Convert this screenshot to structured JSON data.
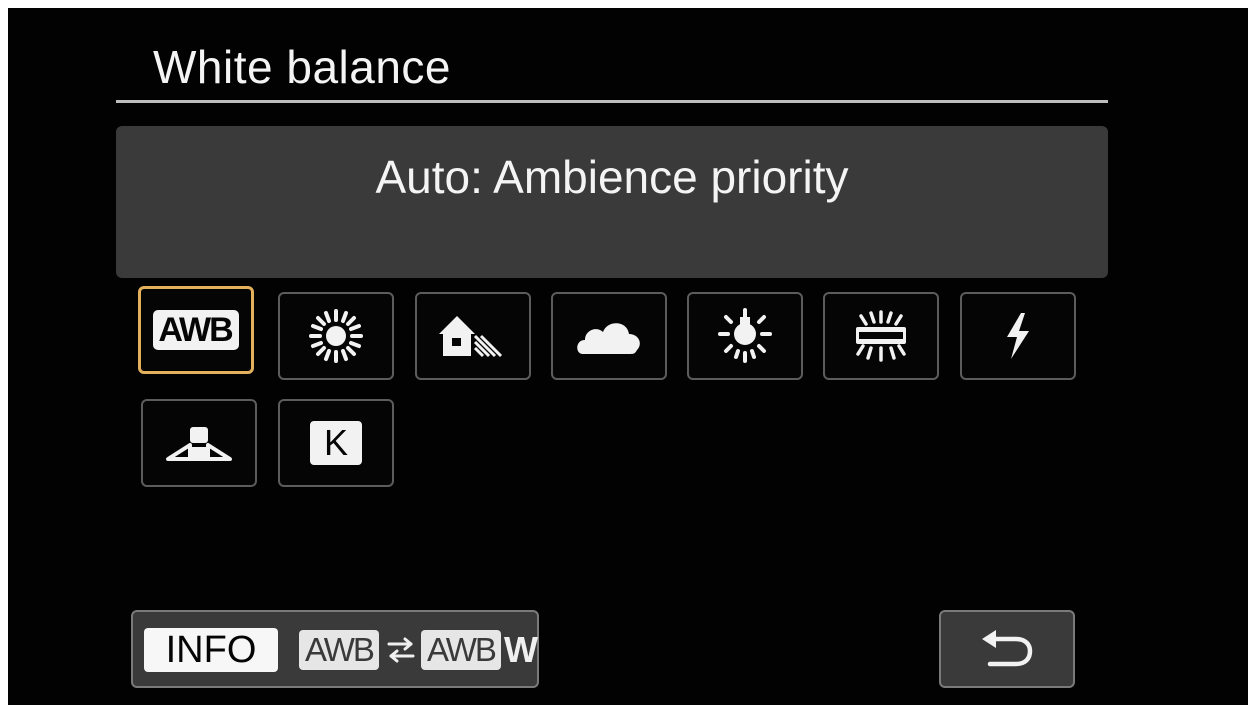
{
  "header": {
    "title": "White balance"
  },
  "mode": {
    "label": "Auto: Ambience priority"
  },
  "options": [
    {
      "icon": "awb-icon",
      "text": "AWB",
      "selected": true
    },
    {
      "icon": "daylight-icon",
      "selected": false
    },
    {
      "icon": "shade-icon",
      "selected": false
    },
    {
      "icon": "cloudy-icon",
      "selected": false
    },
    {
      "icon": "tungsten-icon",
      "selected": false
    },
    {
      "icon": "fluorescent-icon",
      "selected": false
    },
    {
      "icon": "flash-icon",
      "selected": false
    },
    {
      "icon": "custom-wb-icon",
      "selected": false
    },
    {
      "icon": "kelvin-icon",
      "text": "K",
      "selected": false
    }
  ],
  "footer": {
    "info_label": "INFO",
    "awb_left": "AWB",
    "awb_right": "AWB",
    "w_suffix": "W",
    "return_icon": "return-arrow-icon"
  },
  "colors": {
    "background": "#020202",
    "panel": "#3a3a3a",
    "selection": "#e3b05b",
    "text": "#f4f4f4"
  }
}
